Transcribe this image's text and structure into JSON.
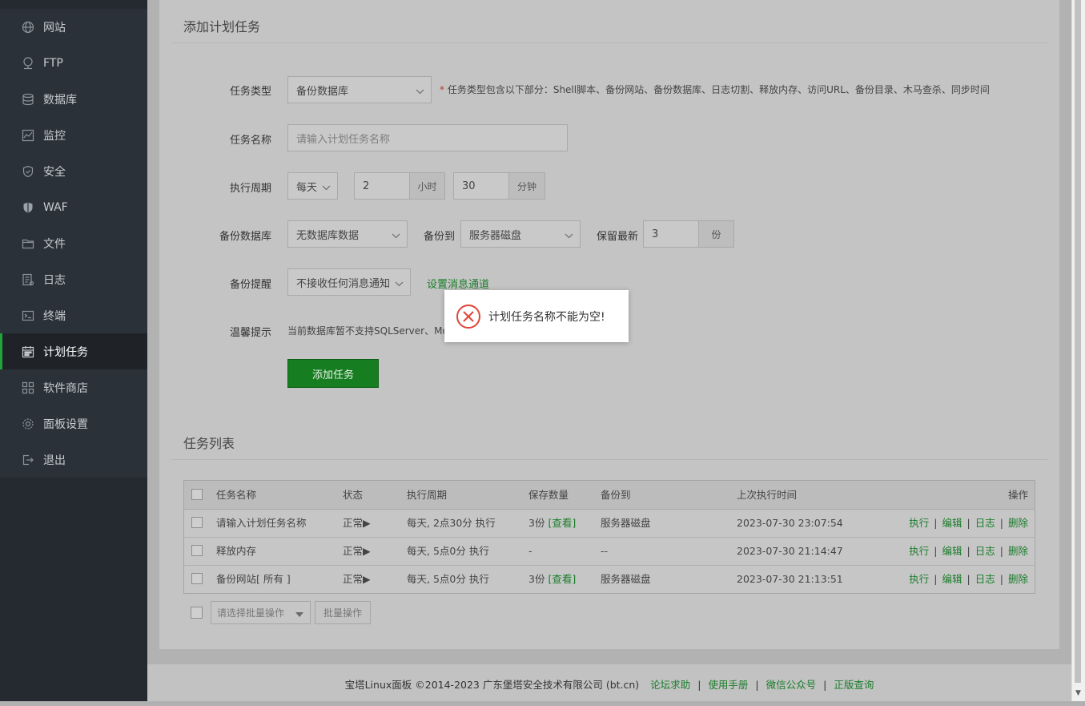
{
  "sidebar": {
    "items": [
      {
        "label": "网站",
        "icon": "globe-icon"
      },
      {
        "label": "FTP",
        "icon": "ftp-icon"
      },
      {
        "label": "数据库",
        "icon": "database-icon"
      },
      {
        "label": "监控",
        "icon": "monitor-icon"
      },
      {
        "label": "安全",
        "icon": "shield-icon"
      },
      {
        "label": "WAF",
        "icon": "waf-shield-icon"
      },
      {
        "label": "文件",
        "icon": "folder-icon"
      },
      {
        "label": "日志",
        "icon": "log-icon"
      },
      {
        "label": "终端",
        "icon": "terminal-icon"
      },
      {
        "label": "计划任务",
        "icon": "calendar-icon",
        "active": true
      },
      {
        "label": "软件商店",
        "icon": "grid-icon"
      },
      {
        "label": "面板设置",
        "icon": "settings-icon"
      },
      {
        "label": "退出",
        "icon": "logout-icon"
      }
    ]
  },
  "form": {
    "title": "添加计划任务",
    "task_type": {
      "label": "任务类型",
      "value": "备份数据库",
      "note_star": "*",
      "note": "任务类型包含以下部分：Shell脚本、备份网站、备份数据库、日志切割、释放内存、访问URL、备份目录、木马查杀、同步时间"
    },
    "task_name": {
      "label": "任务名称",
      "placeholder": "请输入计划任务名称"
    },
    "period": {
      "label": "执行周期",
      "cycle": "每天",
      "hour": "2",
      "hour_unit": "小时",
      "minute": "30",
      "minute_unit": "分钟"
    },
    "backup_db": {
      "label": "备份数据库",
      "value": "无数据库数据",
      "to_label": "备份到",
      "to_value": "服务器磁盘",
      "keep_label": "保留最新",
      "keep_value": "3",
      "keep_unit": "份"
    },
    "notify": {
      "label": "备份提醒",
      "value": "不接收任何消息通知",
      "link": "设置消息通道"
    },
    "tip": {
      "label": "温馨提示",
      "text": "当前数据库暂不支持SQLServer、Mo"
    },
    "submit": "添加任务"
  },
  "task_list": {
    "title": "任务列表",
    "headers": {
      "name": "任务名称",
      "status": "状态",
      "period": "执行周期",
      "keep": "保存数量",
      "backup_to": "备份到",
      "last_run": "上次执行时间",
      "ops": "操作"
    },
    "rows": [
      {
        "name": "请输入计划任务名称",
        "status": "正常▶",
        "period": "每天, 2点30分 执行",
        "keep": "3份",
        "keep_link": "[查看]",
        "backup_to": "服务器磁盘",
        "last_run": "2023-07-30 23:07:54"
      },
      {
        "name": "释放内存",
        "status": "正常▶",
        "period": "每天, 5点0分 执行",
        "keep": "-",
        "keep_link": "",
        "backup_to": "--",
        "last_run": "2023-07-30 21:14:47"
      },
      {
        "name": "备份网站[ 所有 ]",
        "status": "正常▶",
        "period": "每天, 5点0分 执行",
        "keep": "3份",
        "keep_link": "[查看]",
        "backup_to": "服务器磁盘",
        "last_run": "2023-07-30 21:13:51"
      }
    ],
    "ops": {
      "run": "执行",
      "edit": "编辑",
      "log": "日志",
      "delete": "删除",
      "sep": "|"
    },
    "batch_placeholder": "请选择批量操作",
    "batch_button": "批量操作"
  },
  "footer": {
    "copyright": "宝塔Linux面板 ©2014-2023 广东堡塔安全技术有限公司 (bt.cn)",
    "links": [
      "论坛求助",
      "使用手册",
      "微信公众号",
      "正版查询"
    ],
    "sep": "|"
  },
  "toast": {
    "message": "计划任务名称不能为空!",
    "icon": "error-circle-icon"
  },
  "colors": {
    "accent": "#20a53a",
    "link": "#1a7d2a",
    "error": "#e0453a"
  }
}
